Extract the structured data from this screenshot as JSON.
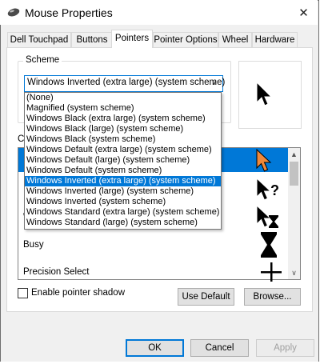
{
  "window": {
    "title": "Mouse Properties",
    "close_glyph": "✕"
  },
  "tabs": [
    {
      "label": "Dell Touchpad",
      "active": false
    },
    {
      "label": "Buttons",
      "active": false
    },
    {
      "label": "Pointers",
      "active": true
    },
    {
      "label": "Pointer Options",
      "active": false
    },
    {
      "label": "Wheel",
      "active": false
    },
    {
      "label": "Hardware",
      "active": false
    }
  ],
  "scheme": {
    "legend": "Scheme",
    "selected": "Windows Inverted (extra large) (system scheme)",
    "options": [
      "(None)",
      "Magnified (system scheme)",
      "Windows Black (extra large) (system scheme)",
      "Windows Black (large) (system scheme)",
      "Windows Black (system scheme)",
      "Windows Default (extra large) (system scheme)",
      "Windows Default (large) (system scheme)",
      "Windows Default (system scheme)",
      "Windows Inverted (extra large) (system scheme)",
      "Windows Inverted (large) (system scheme)",
      "Windows Inverted (system scheme)",
      "Windows Standard (extra large) (system scheme)",
      "Windows Standard (large) (system scheme)"
    ],
    "selected_index": 8
  },
  "customize": {
    "label_partial": "C",
    "rows": [
      {
        "label": "",
        "icon": "arrow-cursor-icon",
        "selected": true
      },
      {
        "label": "",
        "icon": "help-select-cursor-icon",
        "selected": false
      },
      {
        "label": "W",
        "icon": "working-in-background-cursor-icon",
        "selected": false
      },
      {
        "label": "Busy",
        "icon": "hourglass-cursor-icon",
        "selected": false
      },
      {
        "label": "Precision Select",
        "icon": "crosshair-cursor-icon",
        "selected": false
      }
    ]
  },
  "options": {
    "shadow_label": "Enable pointer shadow",
    "shadow_checked": false
  },
  "buttons": {
    "use_default": "Use Default",
    "browse": "Browse...",
    "ok": "OK",
    "cancel": "Cancel",
    "apply": "Apply"
  },
  "colors": {
    "accent": "#0078d7",
    "preview_accent": "#f0883a"
  }
}
